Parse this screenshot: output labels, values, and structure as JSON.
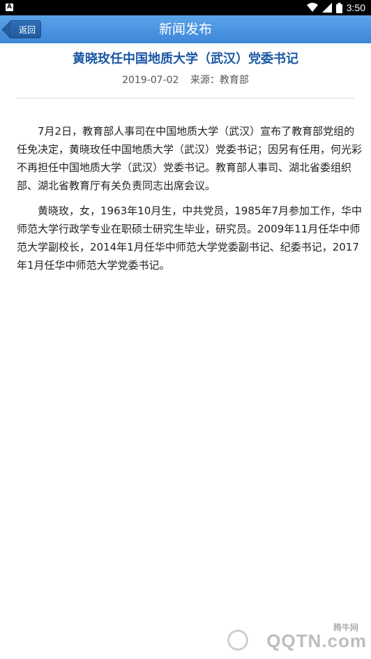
{
  "status_bar": {
    "time": "3:50",
    "left_icon": "A"
  },
  "header": {
    "back_label": "返回",
    "title": "新闻发布"
  },
  "article": {
    "title": "黄晓玫任中国地质大学（武汉）党委书记",
    "date": "2019-07-02",
    "source": "来源：教育部",
    "paragraphs": [
      "7月2日，教育部人事司在中国地质大学（武汉）宣布了教育部党组的任免决定，黄晓玫任中国地质大学（武汉）党委书记；因另有任用，何光彩不再担任中国地质大学（武汉）党委书记。教育部人事司、湖北省委组织部、湖北省教育厅有关负责同志出席会议。",
      "黄晓玫，女，1963年10月生，中共党员，1985年7月参加工作，华中师范大学行政学专业在职硕士研究生毕业，研究员。2009年11月任华中师范大学副校长，2014年1月任华中师范大学党委副书记、纪委书记，2017年1月任华中师范大学党委书记。"
    ]
  },
  "watermark": {
    "small": "腾牛网",
    "big": "QQTN.com"
  }
}
